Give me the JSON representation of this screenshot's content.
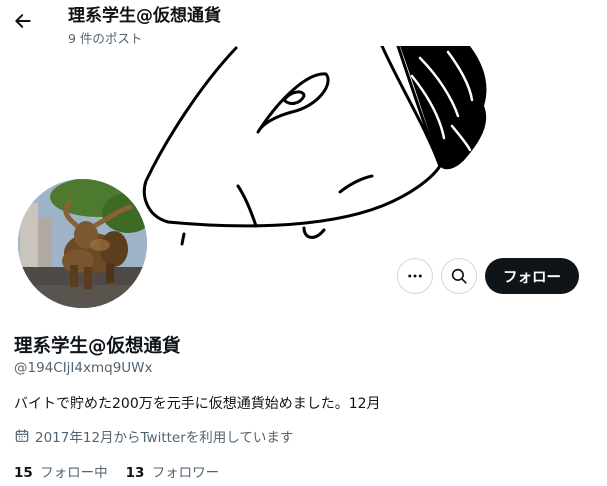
{
  "header": {
    "title": "理系学生@仮想通貨",
    "post_count": "9 件のポスト"
  },
  "profile": {
    "display_name": "理系学生@仮想通貨",
    "handle": "@194CIjI4xmq9UWx",
    "bio": "バイトで貯めた200万を元手に仮想通貨始めました。12月",
    "joined": "2017年12月からTwitterを利用しています"
  },
  "actions": {
    "follow_label": "フォロー"
  },
  "stats": {
    "following_count": "15",
    "following_label": "フォロー中",
    "followers_count": "13",
    "followers_label": "フォロワー"
  },
  "icons": {
    "back": "arrow-left-icon",
    "more": "more-horizontal-icon",
    "search": "search-icon",
    "joined": "calendar-icon"
  },
  "colors": {
    "text_primary": "#0f1419",
    "text_secondary": "#536471",
    "follow_button_bg": "#0f1419",
    "border": "#cfd9de"
  }
}
